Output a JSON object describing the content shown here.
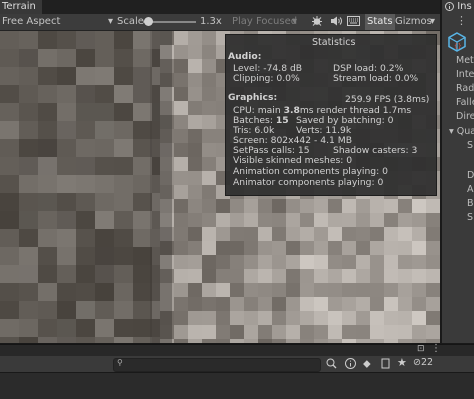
{
  "game_view": {
    "tab_label": "Terrain",
    "aspect": "Free Aspect",
    "scale_label": "Scale",
    "scale_value": "1.3x",
    "play_focused": "Play Focused",
    "stats_label": "Stats",
    "gizmos_label": "Gizmos"
  },
  "statistics": {
    "title": "Statistics",
    "audio_header": "Audio:",
    "level": "Level: -74.8 dB",
    "dsp_load": "DSP load: 0.2%",
    "clipping": "Clipping: 0.0%",
    "stream_load": "Stream load: 0.0%",
    "graphics_header": "Graphics:",
    "fps": "259.9 FPS (3.8ms)",
    "cpu_prefix": "CPU: main ",
    "cpu_main": "3.8",
    "cpu_suffix": "ms  render thread 1.7ms",
    "batches_prefix": "Batches: ",
    "batches": "15",
    "saved_by_batching": "Saved by batching: 0",
    "tris": "Tris: 6.0k",
    "verts": "Verts: 11.9k",
    "screen": "Screen: 802x442 - 4.1 MB",
    "setpass": "SetPass calls: 15",
    "shadow_casters": "Shadow casters: 3",
    "visible_skinned": "Visible skinned meshes: 0",
    "animation_components": "Animation components playing: 0",
    "animator_components": "Animator components playing: 0"
  },
  "inspector": {
    "tab_label": "Ins",
    "rows": [
      "Met",
      "Inte",
      "Rad",
      "Falle",
      "Dire"
    ],
    "sub_rows": [
      "Qua",
      "S"
    ],
    "deep_rows": [
      "D",
      "A",
      "B",
      "S"
    ]
  },
  "console": {
    "search_icon": "search-icon",
    "message_count": "22"
  },
  "colors": {
    "stats_button_active": "#5a5a5a",
    "panel_bg": "#3c3c3c",
    "overlay_bg": "#2e2e2e"
  }
}
